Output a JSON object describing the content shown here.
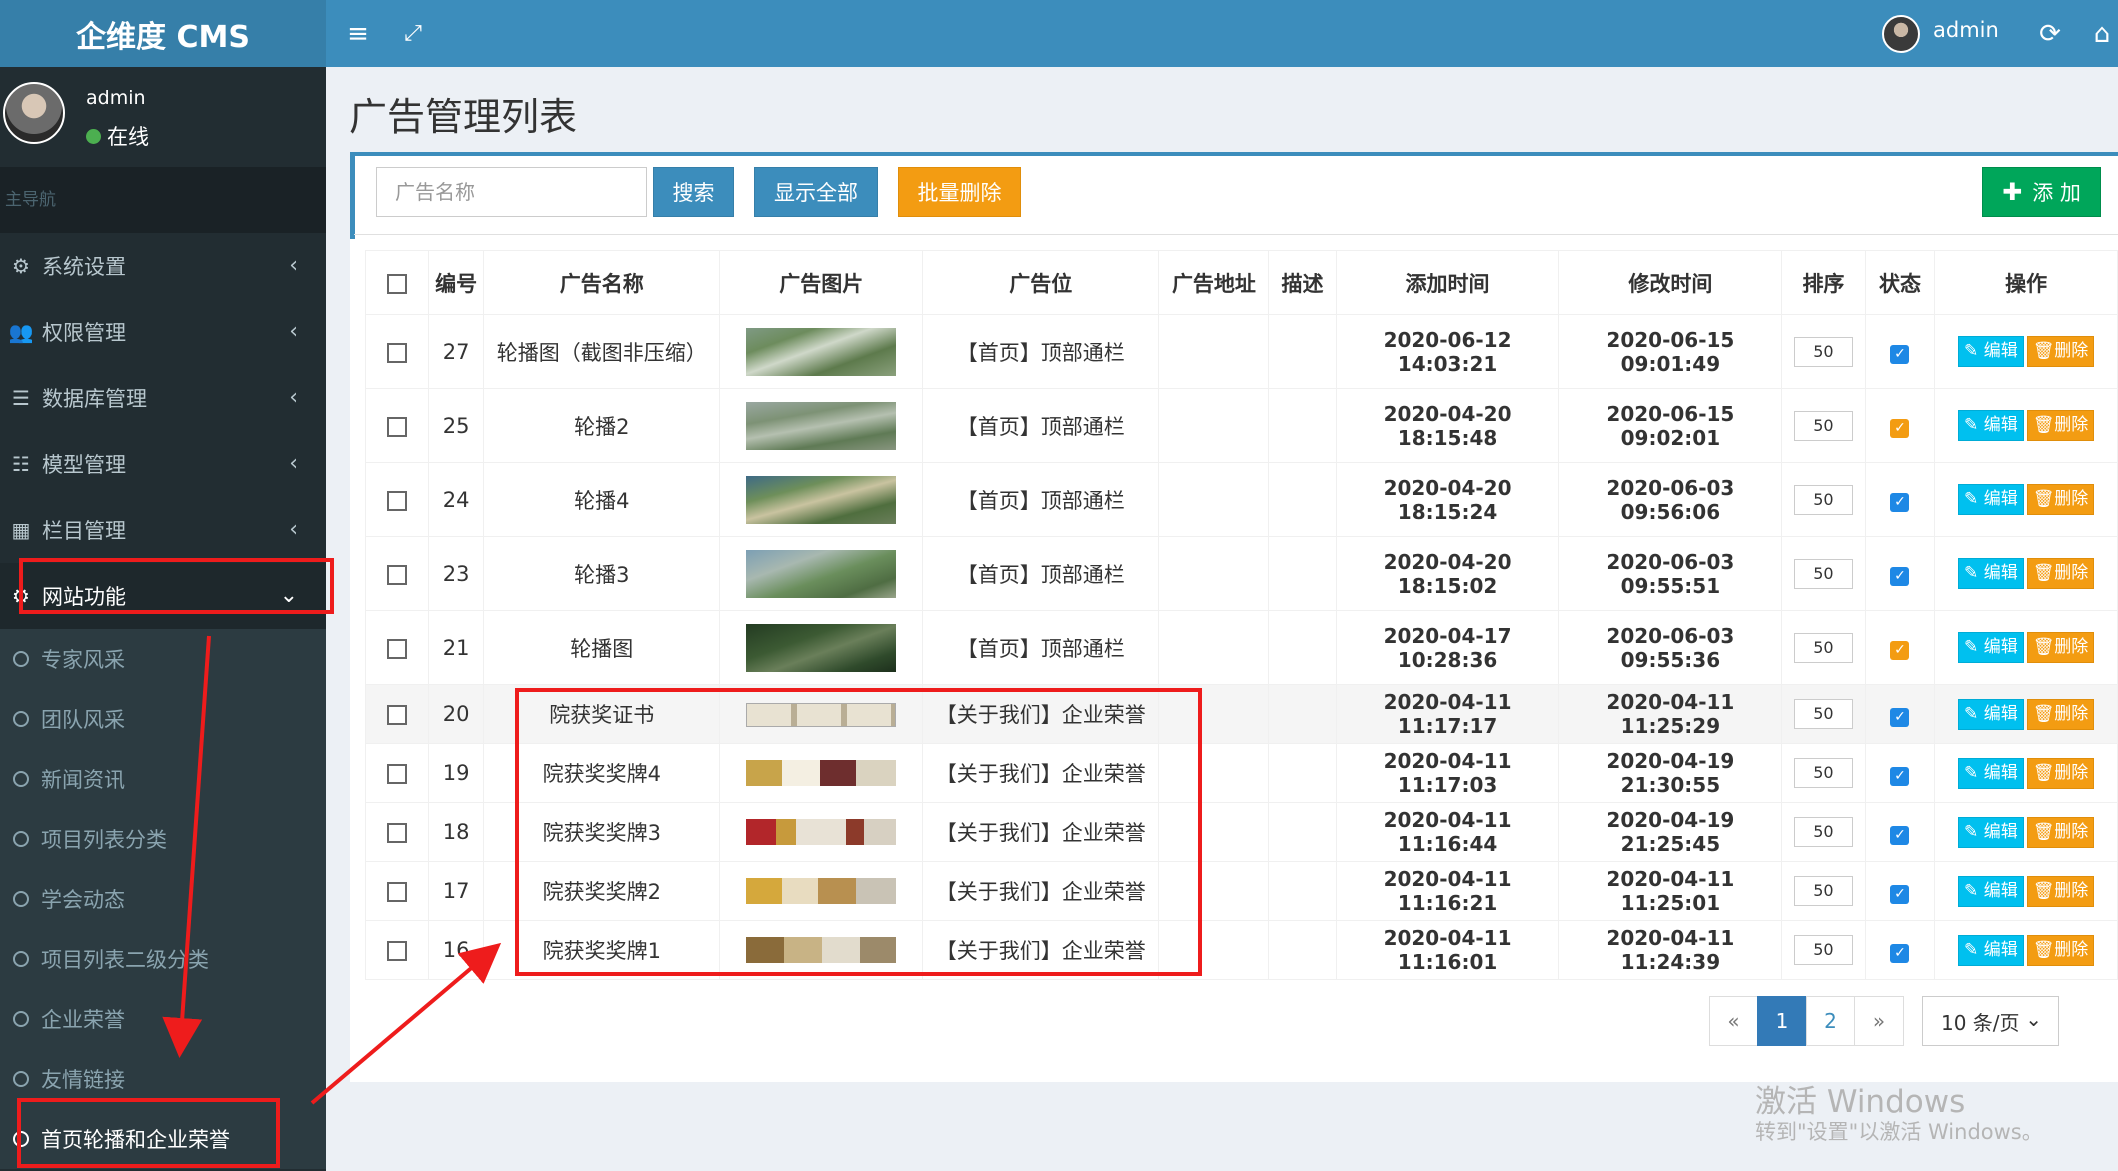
{
  "brand": "企维度 CMS",
  "topbar": {
    "user": "admin"
  },
  "user_panel": {
    "name": "admin",
    "status": "在线"
  },
  "nav": {
    "header": "主导航",
    "items": [
      {
        "label": "系统设置",
        "icon": "gears-icon"
      },
      {
        "label": "权限管理",
        "icon": "users-icon"
      },
      {
        "label": "数据库管理",
        "icon": "database-icon"
      },
      {
        "label": "模型管理",
        "icon": "list-icon"
      },
      {
        "label": "栏目管理",
        "icon": "grid-icon"
      },
      {
        "label": "网站功能",
        "icon": "gear-icon"
      }
    ],
    "subitems": [
      "专家风采",
      "团队风采",
      "新闻资讯",
      "项目列表分类",
      "学会动态",
      "项目列表二级分类",
      "企业荣誉",
      "友情链接",
      "首页轮播和企业荣誉"
    ]
  },
  "page": {
    "title": "广告管理列表"
  },
  "filter": {
    "placeholder": "广告名称",
    "search": "搜索",
    "show_all": "显示全部",
    "batch_delete": "批量删除",
    "add": "添 加"
  },
  "table": {
    "headers": [
      "编号",
      "广告名称",
      "广告图片",
      "广告位",
      "广告地址",
      "描述",
      "添加时间",
      "修改时间",
      "排序",
      "状态",
      "操作"
    ],
    "edit_label": "编辑",
    "delete_label": "删除",
    "rows": [
      {
        "id": "27",
        "name": "轮播图（截图非压缩）",
        "image": "aerial1",
        "position": "【首页】顶部通栏",
        "url": "",
        "desc": "",
        "added": "2020-06-12 14:03:21",
        "modified": "2020-06-15 09:01:49",
        "sort": "50",
        "status": "blue"
      },
      {
        "id": "25",
        "name": "轮播2",
        "image": "aerial2",
        "position": "【首页】顶部通栏",
        "url": "",
        "desc": "",
        "added": "2020-04-20 18:15:48",
        "modified": "2020-06-15 09:02:01",
        "sort": "50",
        "status": "orange"
      },
      {
        "id": "24",
        "name": "轮播4",
        "image": "aerial3",
        "position": "【首页】顶部通栏",
        "url": "",
        "desc": "",
        "added": "2020-04-20 18:15:24",
        "modified": "2020-06-03 09:56:06",
        "sort": "50",
        "status": "blue"
      },
      {
        "id": "23",
        "name": "轮播3",
        "image": "aerial4",
        "position": "【首页】顶部通栏",
        "url": "",
        "desc": "",
        "added": "2020-04-20 18:15:02",
        "modified": "2020-06-03 09:55:51",
        "sort": "50",
        "status": "blue"
      },
      {
        "id": "21",
        "name": "轮播图",
        "image": "aerial5",
        "position": "【首页】顶部通栏",
        "url": "",
        "desc": "",
        "added": "2020-04-17 10:28:36",
        "modified": "2020-06-03 09:55:36",
        "sort": "50",
        "status": "orange"
      },
      {
        "id": "20",
        "name": "院获奖证书",
        "image": "cert1",
        "position": "【关于我们】企业荣誉",
        "url": "",
        "desc": "",
        "added": "2020-04-11 11:17:17",
        "modified": "2020-04-11 11:25:29",
        "sort": "50",
        "status": "blue"
      },
      {
        "id": "19",
        "name": "院获奖奖牌4",
        "image": "cert2",
        "position": "【关于我们】企业荣誉",
        "url": "",
        "desc": "",
        "added": "2020-04-11 11:17:03",
        "modified": "2020-04-19 21:30:55",
        "sort": "50",
        "status": "blue"
      },
      {
        "id": "18",
        "name": "院获奖奖牌3",
        "image": "cert3",
        "position": "【关于我们】企业荣誉",
        "url": "",
        "desc": "",
        "added": "2020-04-11 11:16:44",
        "modified": "2020-04-19 21:25:45",
        "sort": "50",
        "status": "blue"
      },
      {
        "id": "17",
        "name": "院获奖奖牌2",
        "image": "cert4",
        "position": "【关于我们】企业荣誉",
        "url": "",
        "desc": "",
        "added": "2020-04-11 11:16:21",
        "modified": "2020-04-11 11:25:01",
        "sort": "50",
        "status": "blue"
      },
      {
        "id": "16",
        "name": "院获奖奖牌1",
        "image": "cert5",
        "position": "【关于我们】企业荣誉",
        "url": "",
        "desc": "",
        "added": "2020-04-11 11:16:01",
        "modified": "2020-04-11 11:24:39",
        "sort": "50",
        "status": "blue"
      }
    ]
  },
  "pagination": {
    "prev": "«",
    "pages": [
      "1",
      "2"
    ],
    "next": "»",
    "page_size": "10 条/页"
  },
  "watermark": {
    "line1": "激活 Windows",
    "line2": "转到\"设置\"以激活 Windows。"
  },
  "colors": {
    "header": "#3c8dbc",
    "sidebar": "#222d32",
    "annotation": "#ee1c1c",
    "status_on": "#1e88e5",
    "status_alt": "#f39c12"
  }
}
